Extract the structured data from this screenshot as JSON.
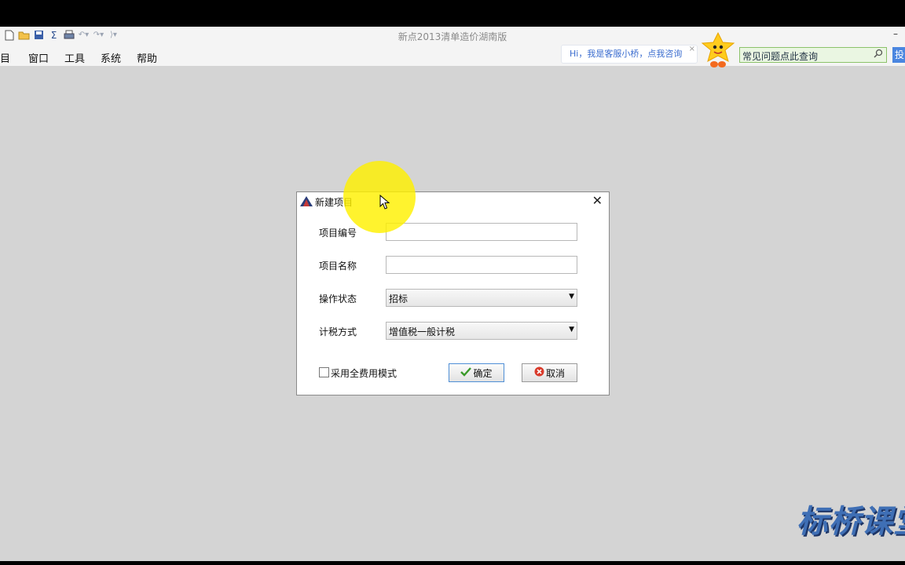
{
  "app": {
    "title": "新点2013清单造价湖南版",
    "minimize": "–"
  },
  "quick_access": {
    "icons": [
      "new-file-icon",
      "open-folder-icon",
      "save-icon",
      "sum-icon",
      "print-icon",
      "undo-icon",
      "redo-icon",
      "customize-icon"
    ],
    "sum_symbol": "Σ"
  },
  "menu": {
    "items": [
      "目",
      "窗口",
      "工具",
      "系统",
      "帮助"
    ]
  },
  "assistant": {
    "bubble_text": "Hi，我是客服小桥，点我咨询",
    "bubble_close": "×",
    "search_placeholder": "常见问题点此查询",
    "side_button": "投"
  },
  "dialog": {
    "title": "新建项目",
    "close": "✕",
    "fields": {
      "project_number_label": "项目编号",
      "project_number_value": "",
      "project_name_label": "项目名称",
      "project_name_value": "",
      "operation_status_label": "操作状态",
      "operation_status_value": "招标",
      "tax_method_label": "计税方式",
      "tax_method_value": "增值税一般计税"
    },
    "full_fee_mode_label": "采用全费用模式",
    "full_fee_mode_checked": false,
    "ok_label": "确定",
    "cancel_label": "取消"
  },
  "watermark": "标桥课堂",
  "colors": {
    "background": "#d4d4d4",
    "accent_blue": "#3a6ccf",
    "highlight": "#fff000"
  }
}
